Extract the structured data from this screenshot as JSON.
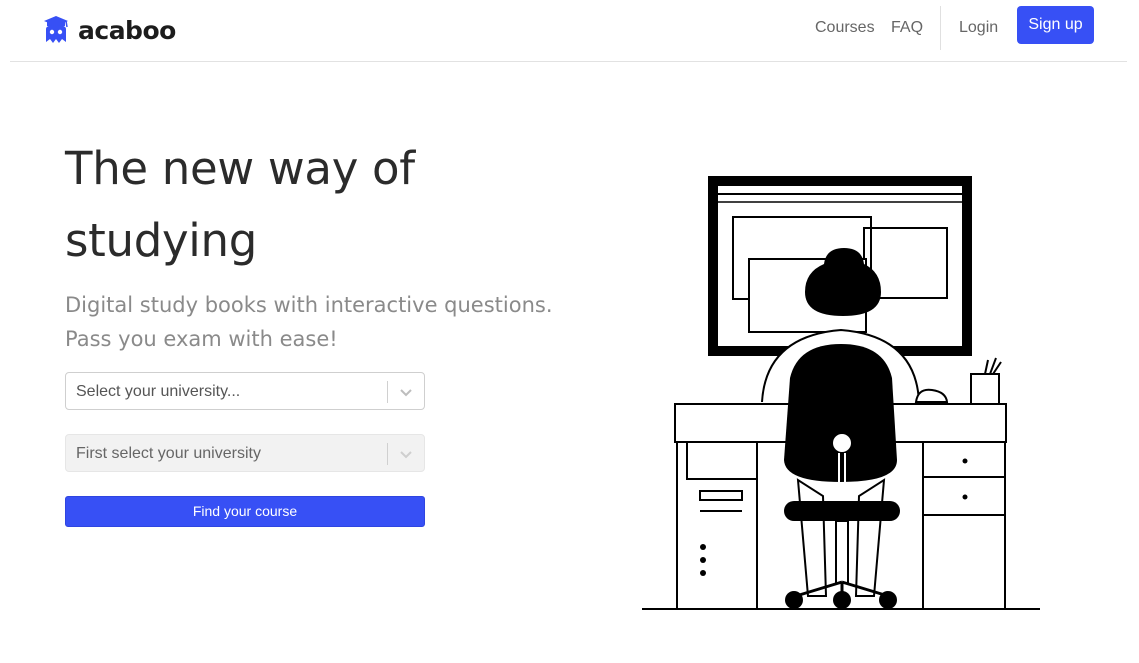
{
  "header": {
    "brand": "acaboo",
    "nav": {
      "courses": "Courses",
      "faq": "FAQ",
      "login": "Login",
      "signup": "Sign up"
    }
  },
  "hero": {
    "title": "The new way of studying",
    "subtitle": "Digital study books with interactive questions. Pass you exam with ease!"
  },
  "search": {
    "university_placeholder": "Select your university...",
    "course_placeholder": "First select your university",
    "submit_label": "Find your course"
  },
  "colors": {
    "accent": "#3750f5",
    "text": "#2b2b2b",
    "muted": "#8a8a8a"
  },
  "icons": [
    "acaboo-logo-icon",
    "chevron-down-icon",
    "student-at-desk-illustration"
  ]
}
